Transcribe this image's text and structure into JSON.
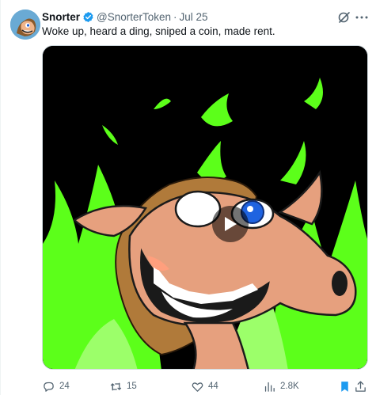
{
  "tweet": {
    "author_name": "Snorter",
    "handle": "@SnorterToken",
    "separator": "·",
    "date": "Jul 25",
    "text": "Woke up, heard a ding, sniped a coin, made rent."
  },
  "actions": {
    "replies": "24",
    "reposts": "15",
    "likes": "44",
    "views": "2.8K"
  },
  "colors": {
    "verified": "#1d9bf0",
    "bookmark_active": "#1d9bf0",
    "flame_green": "#5cff1a"
  }
}
